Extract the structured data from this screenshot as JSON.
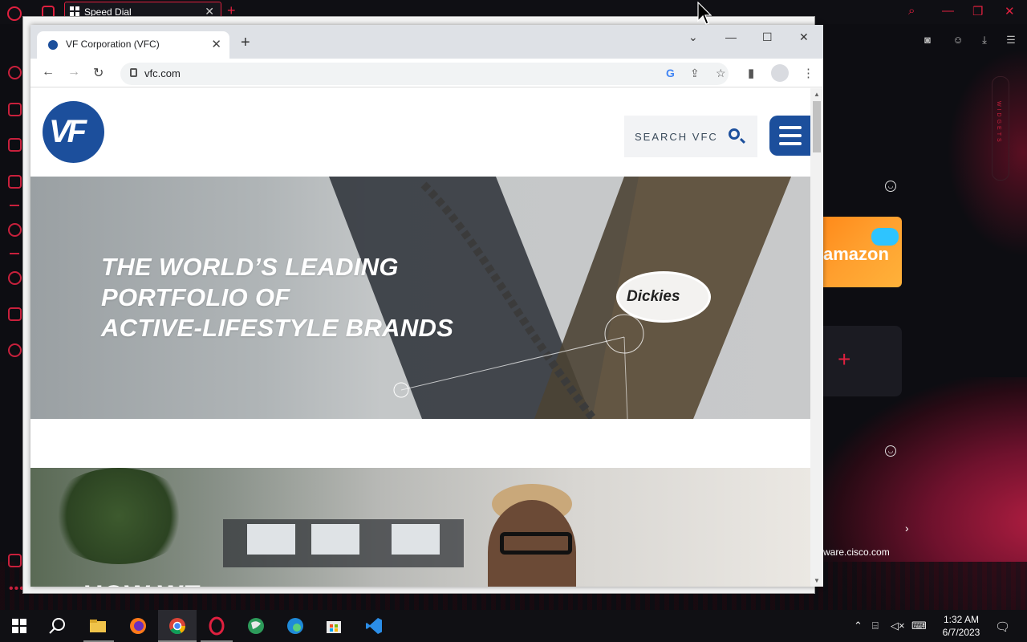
{
  "opera": {
    "tab_title": "Speed Dial",
    "new_tab_symbol": "+",
    "close_symbol": "✕",
    "widgets_label": "WIDGETS",
    "tiles": [
      {
        "name": "amazon",
        "label": "amazon"
      },
      {
        "name": "add",
        "label": "+"
      }
    ],
    "tile_caption": "ware.cisco.com",
    "chevron": "›"
  },
  "chrome": {
    "tab_title": "VF Corporation (VFC)",
    "tab_close": "✕",
    "new_tab": "+",
    "window_buttons": {
      "dropdown": "⌄",
      "minimize": "—",
      "maximize": "☐",
      "close": "✕"
    },
    "address": "vfc.com",
    "nav": {
      "back": "←",
      "forward": "→",
      "reload": "↻"
    },
    "toolbar_icons": {
      "google": "G",
      "share": "⇪",
      "star": "☆",
      "sidepanel": "▮",
      "menu": "⋮"
    }
  },
  "page": {
    "logo_text": "VF",
    "search_label": "SEARCH VFC",
    "hero_headline": [
      "THE WORLD’S LEADING",
      "PORTFOLIO OF",
      "ACTIVE-LIFESTYLE BRANDS"
    ],
    "brand_badge": "Dickies",
    "next_section_text": "HOW WE"
  },
  "taskbar": {
    "apps": [
      "windows-start",
      "search",
      "file-explorer",
      "firefox",
      "chrome",
      "opera",
      "maps",
      "edge",
      "microsoft-store",
      "vscode"
    ],
    "time": "1:32 AM",
    "date": "6/7/2023"
  },
  "colors": {
    "vf_blue": "#1c4f9c",
    "opera_red": "#e0203f",
    "chrome_tabstrip": "#dee1e6"
  }
}
